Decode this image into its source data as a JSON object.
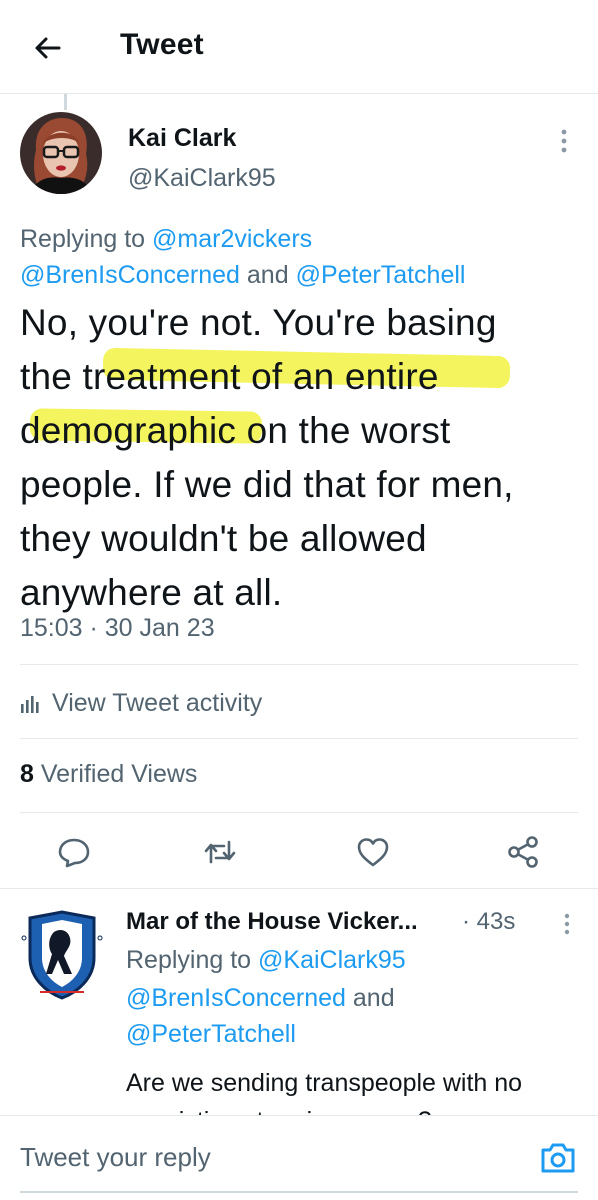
{
  "header": {
    "title": "Tweet",
    "back_icon": "arrow-left-icon"
  },
  "tweet": {
    "author": {
      "name": "Kai Clark",
      "handle": "@KaiClark95",
      "avatar": "avatar-photo"
    },
    "replying_to": {
      "prefix": "Replying to",
      "mention1": "@mar2vickers",
      "mention2": "@BrenIsConcerned",
      "and": "and",
      "mention3": "@PeterTatchell"
    },
    "text_lines": [
      "No, you're not. You're basing",
      "the treatment of an entire",
      "demographic on the worst",
      "people. If we did that for men,",
      "they wouldn't be allowed",
      "anywhere at all."
    ],
    "timestamp": "15:03 · 30 Jan 23",
    "highlight_color": "#f0f028"
  },
  "activity": {
    "label": "View Tweet activity",
    "icon": "analytics-bars-icon"
  },
  "views": {
    "count": "8",
    "label": "Verified Views"
  },
  "actions": {
    "reply_icon": "comment-icon",
    "retweet_icon": "retweet-icon",
    "like_icon": "heart-icon",
    "share_icon": "share-icon"
  },
  "reply": {
    "author_name": "Mar of the House Vicker...",
    "time": "· 43s",
    "replying_prefix": "Replying to",
    "mention1": "@KaiClark95",
    "mention2": "@BrenIsConcerned",
    "and": "and",
    "mention3": "@PeterTatchell",
    "text": "Are we sending transpeople with no convictions to prisons now?"
  },
  "composer": {
    "placeholder": "Tweet your reply",
    "camera_icon": "camera-icon"
  },
  "colors": {
    "link": "#1d9bf0",
    "secondary": "#536471",
    "text": "#0f1419",
    "divider": "#e6e9eb"
  }
}
